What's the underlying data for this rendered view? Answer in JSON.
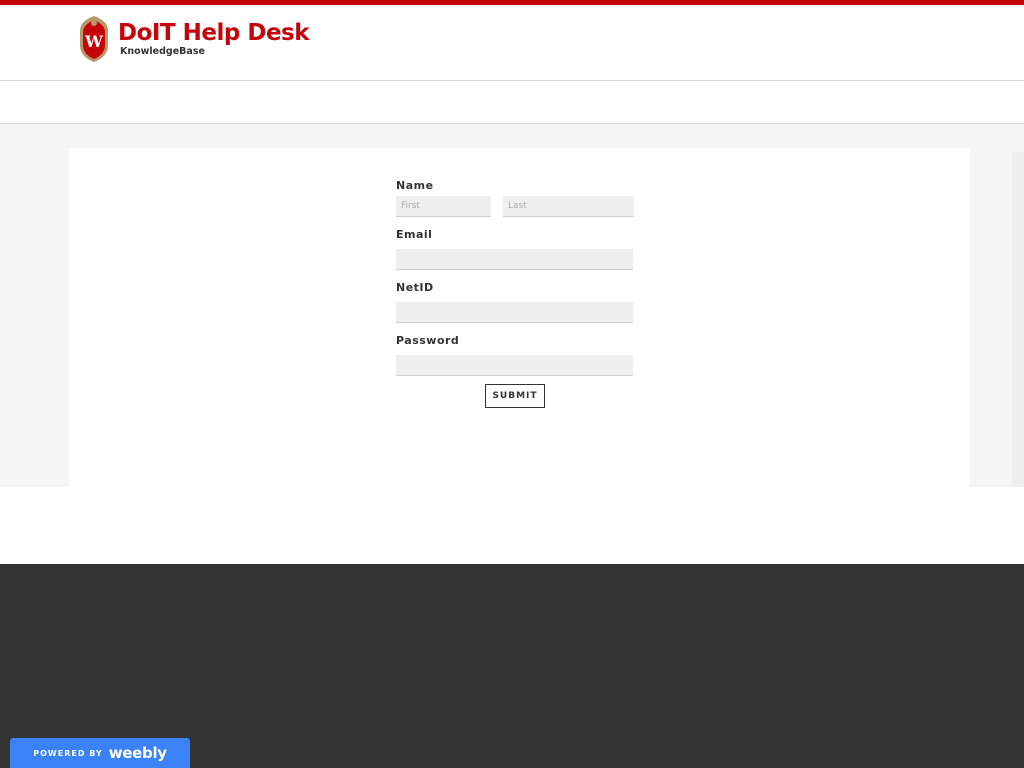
{
  "header": {
    "title": "DoIT Help Desk",
    "subtitle": "KnowledgeBase",
    "crest_letter": "W"
  },
  "form": {
    "name_label": "Name",
    "first_placeholder": "First",
    "last_placeholder": "Last",
    "email_label": "Email",
    "netid_label": "NetID",
    "password_label": "Password",
    "submit_label": "SUBMIT"
  },
  "badge": {
    "powered_by": "POWERED BY",
    "brand": "weebly"
  },
  "colors": {
    "brand_red": "#c5050c",
    "footer": "#333333",
    "badge_blue": "#3b82f6"
  }
}
